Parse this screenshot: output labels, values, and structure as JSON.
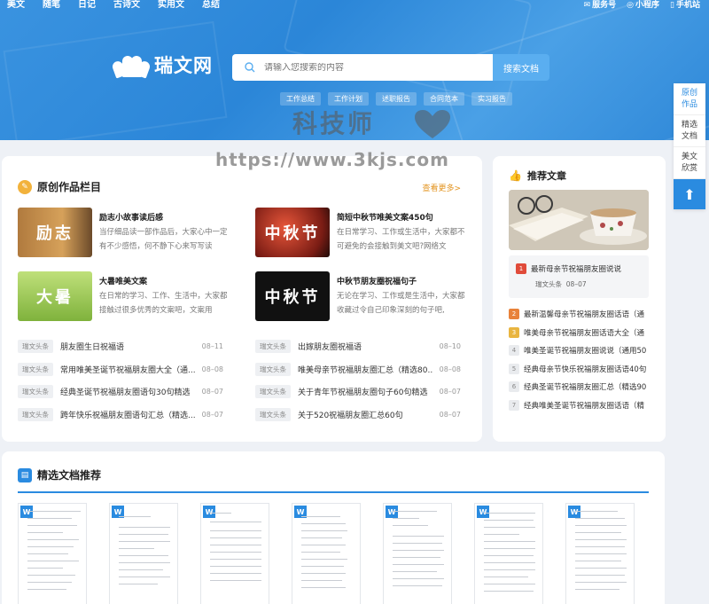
{
  "topnav": [
    "美文",
    "随笔",
    "日记",
    "古诗文",
    "实用文",
    "总结"
  ],
  "topright": [
    {
      "icon": "wechat-icon",
      "label": "服务号"
    },
    {
      "icon": "miniprogram-icon",
      "label": "小程序"
    },
    {
      "icon": "mobile-icon",
      "label": "手机站"
    }
  ],
  "logo": {
    "name": "瑞文网"
  },
  "search": {
    "placeholder": "请输入您搜索的内容",
    "button": "搜索文档"
  },
  "tags": [
    "工作总结",
    "工作计划",
    "述职报告",
    "合同范本",
    "实习报告"
  ],
  "watermark": {
    "text": "科技师",
    "url": "https://www.3kjs.com"
  },
  "float_menu": [
    "原创作品",
    "精选文档",
    "美文欣赏"
  ],
  "original": {
    "title": "原创作品栏目",
    "more": "查看更多>",
    "featured": [
      {
        "thumb": "励志",
        "title": "励志小故事读后感",
        "desc": "当仔细品读一部作品后，大家心中一定有不少感悟，何不静下心来写写读"
      },
      {
        "thumb": "中秋节",
        "title": "简短中秋节唯美文案450句",
        "desc": "在日常学习、工作或生活中，大家都不可避免的会接触到美文吧?网络文"
      },
      {
        "thumb": "大暑",
        "title": "大暑唯美文案",
        "desc": "在日常的学习、工作、生活中，大家都接触过很多优秀的文案吧，文案用"
      },
      {
        "thumb": "中秋节",
        "title": "中秋节朋友圈祝福句子",
        "desc": "无论在学习、工作或是生活中，大家都收藏过令自己印象深刻的句子吧,"
      }
    ],
    "list_left": [
      {
        "badge": "瑞文头条",
        "text": "朋友圈生日祝福语",
        "date": "08–11"
      },
      {
        "badge": "瑞文头条",
        "text": "常用唯美圣诞节祝福朋友圈大全（通...",
        "date": "08–08"
      },
      {
        "badge": "瑞文头条",
        "text": "经典圣诞节祝福朋友圈语句30句精选",
        "date": "08–07"
      },
      {
        "badge": "瑞文头条",
        "text": "跨年快乐祝福朋友圈语句汇总（精选...",
        "date": "08–07"
      }
    ],
    "list_right": [
      {
        "badge": "瑞文头条",
        "text": "出嫁朋友圈祝福语",
        "date": "08–10"
      },
      {
        "badge": "瑞文头条",
        "text": "唯美母亲节祝福朋友圈汇总（精选80...",
        "date": "08–08"
      },
      {
        "badge": "瑞文头条",
        "text": "关于青年节祝福朋友圈句子60句精选",
        "date": "08–07"
      },
      {
        "badge": "瑞文头条",
        "text": "关于520祝福朋友圈汇总60句",
        "date": "08–07"
      }
    ]
  },
  "recommend": {
    "title": "推荐文章",
    "first": {
      "num": "1",
      "title": "最新母亲节祝福朋友圈说说",
      "badge": "瑞文头条",
      "date": "08–07"
    },
    "items": [
      {
        "num": "2",
        "text": "最新温馨母亲节祝福朋友圈话语（通"
      },
      {
        "num": "3",
        "text": "唯美母亲节祝福朋友圈话语大全（通"
      },
      {
        "num": "4",
        "text": "唯美圣诞节祝福朋友圈说说（通用50"
      },
      {
        "num": "5",
        "text": "经典母亲节快乐祝福朋友圈话语40句"
      },
      {
        "num": "6",
        "text": "经典圣诞节祝福朋友圈汇总（精选90"
      },
      {
        "num": "7",
        "text": "经典唯美圣诞节祝福朋友圈话语（精"
      }
    ],
    "num_colors": {
      "1": "#e04b3a",
      "2": "#e8823a",
      "3": "#e9b540"
    }
  },
  "docs": {
    "title": "精选文档推荐",
    "badge": "W",
    "count": 7
  },
  "colors": {
    "accent": "#2a8be0",
    "more": "#e39420"
  }
}
